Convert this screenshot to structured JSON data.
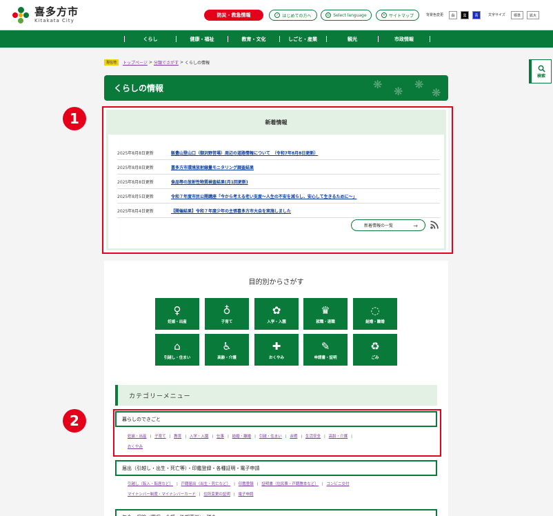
{
  "header": {
    "logo_title": "喜多方市",
    "logo_sub": "Kitakata City",
    "emergency_label": "防災・救急情報",
    "first_time_label": "はじめての方へ",
    "language_label": "Select language",
    "sitemap_label": "サイトマップ",
    "bg_color_label": "背景色変更",
    "bg_options": [
      "白",
      "黒",
      "青"
    ],
    "font_size_label": "文字サイズ",
    "font_standard": "標準",
    "font_large": "拡大"
  },
  "gnav": [
    "くらし",
    "健康・福祉",
    "教育・文化",
    "しごと・産業",
    "観光",
    "市政情報"
  ],
  "breadcrumb": {
    "badge": "現在地",
    "items": [
      "トップページ",
      "分類でさがす"
    ],
    "current": "くらしの情報",
    "sep": ">"
  },
  "page_title": "くらしの情報",
  "markers": [
    "1",
    "2"
  ],
  "news": {
    "heading": "新着情報",
    "items": [
      {
        "date": "2025年8月8日更新",
        "title": "飯豊山登山口（御沢野営場）周辺の道路情報について　（令和7年8月8日更新）"
      },
      {
        "date": "2025年8月8日更新",
        "title": "喜多方市環境放射線量モニタリング調査結果"
      },
      {
        "date": "2025年8月8日更新",
        "title": "食品等の放射性物質検査結果(月1回更新)"
      },
      {
        "date": "2025年8月5日更新",
        "title": "令和７年度市民公開講座「今から考える老い支度～人生の不安を減らし、安心して生きるために～」"
      },
      {
        "date": "2025年8月4日更新",
        "title": "【開催結果】令和７年度少年の主張喜多方市大会を実施しました"
      }
    ],
    "more_label": "新着情報の一覧",
    "more_arrow": "→"
  },
  "purpose": {
    "heading": "目的別からさがす",
    "tiles": [
      {
        "label": "妊娠・出産",
        "icon": "pregnancy-icon",
        "glyph": "♀"
      },
      {
        "label": "子育て",
        "icon": "baby-bottle-icon",
        "glyph": "♁"
      },
      {
        "label": "入学・入園",
        "icon": "flower-badge-icon",
        "glyph": "✿"
      },
      {
        "label": "就職・退職",
        "icon": "suit-icon",
        "glyph": "♛"
      },
      {
        "label": "結婚・離婚",
        "icon": "ring-icon",
        "glyph": "◌"
      },
      {
        "label": "引越し・住まい",
        "icon": "house-icon",
        "glyph": "⌂"
      },
      {
        "label": "高齢・介護",
        "icon": "wheelchair-icon",
        "glyph": "♿"
      },
      {
        "label": "おくやみ",
        "icon": "ribbon-icon",
        "glyph": "✚"
      },
      {
        "label": "申請書・証明",
        "icon": "document-pen-icon",
        "glyph": "✎"
      },
      {
        "label": "ごみ",
        "icon": "trash-icon",
        "glyph": "♻"
      }
    ]
  },
  "category": {
    "heading": "カテゴリーメニュー",
    "sections": [
      {
        "title": "暮らしのできごと",
        "links": [
          "妊娠・出産",
          "子育て",
          "教育",
          "入学・入園",
          "仕事",
          "結婚・離婚",
          "引越・住まい",
          "余暇",
          "生活安全",
          "高齢・介護",
          "おくやみ"
        ]
      },
      {
        "title": "届出（引越し・出生・死亡等）・印鑑登録・各種証明・電子申請",
        "links": [
          "引越し（転入・転居など）",
          "戸籍届出（出生・死亡など）",
          "印鑑登録",
          "証明書（住民票・戸籍謄本など）",
          "コンビニ交付",
          "マイナンバー制度・マイナンバーカード",
          "住所変更の証明",
          "電子申請"
        ]
      },
      {
        "title": "年金・保険（国保・介護・後期高齢）・税金"
      }
    ]
  },
  "search_tab": "検索"
}
